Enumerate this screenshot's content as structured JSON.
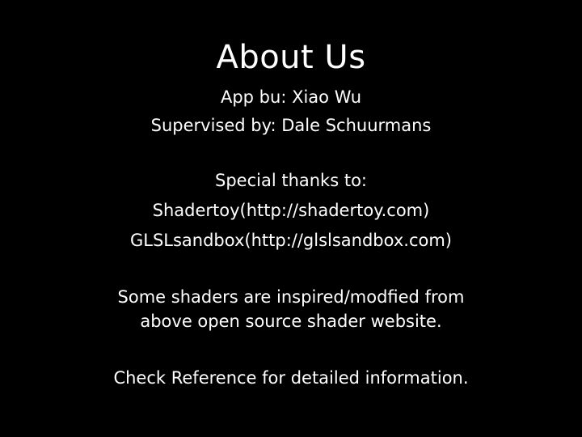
{
  "colors": {
    "background": "#000000",
    "text": "#ffffff"
  },
  "title": "About Us",
  "credits": {
    "app_by": "App bu: Xiao Wu",
    "supervised_by": "Supervised by: Dale Schuurmans"
  },
  "thanks": {
    "heading": "Special thanks to:",
    "items": [
      "Shadertoy(http://shadertoy.com)",
      "GLSLsandbox(http://glslsandbox.com)"
    ]
  },
  "note": {
    "lines": [
      "Some shaders are inspired/modfied from",
      "above open source shader website."
    ]
  },
  "reference": "Check Reference for detailed information."
}
